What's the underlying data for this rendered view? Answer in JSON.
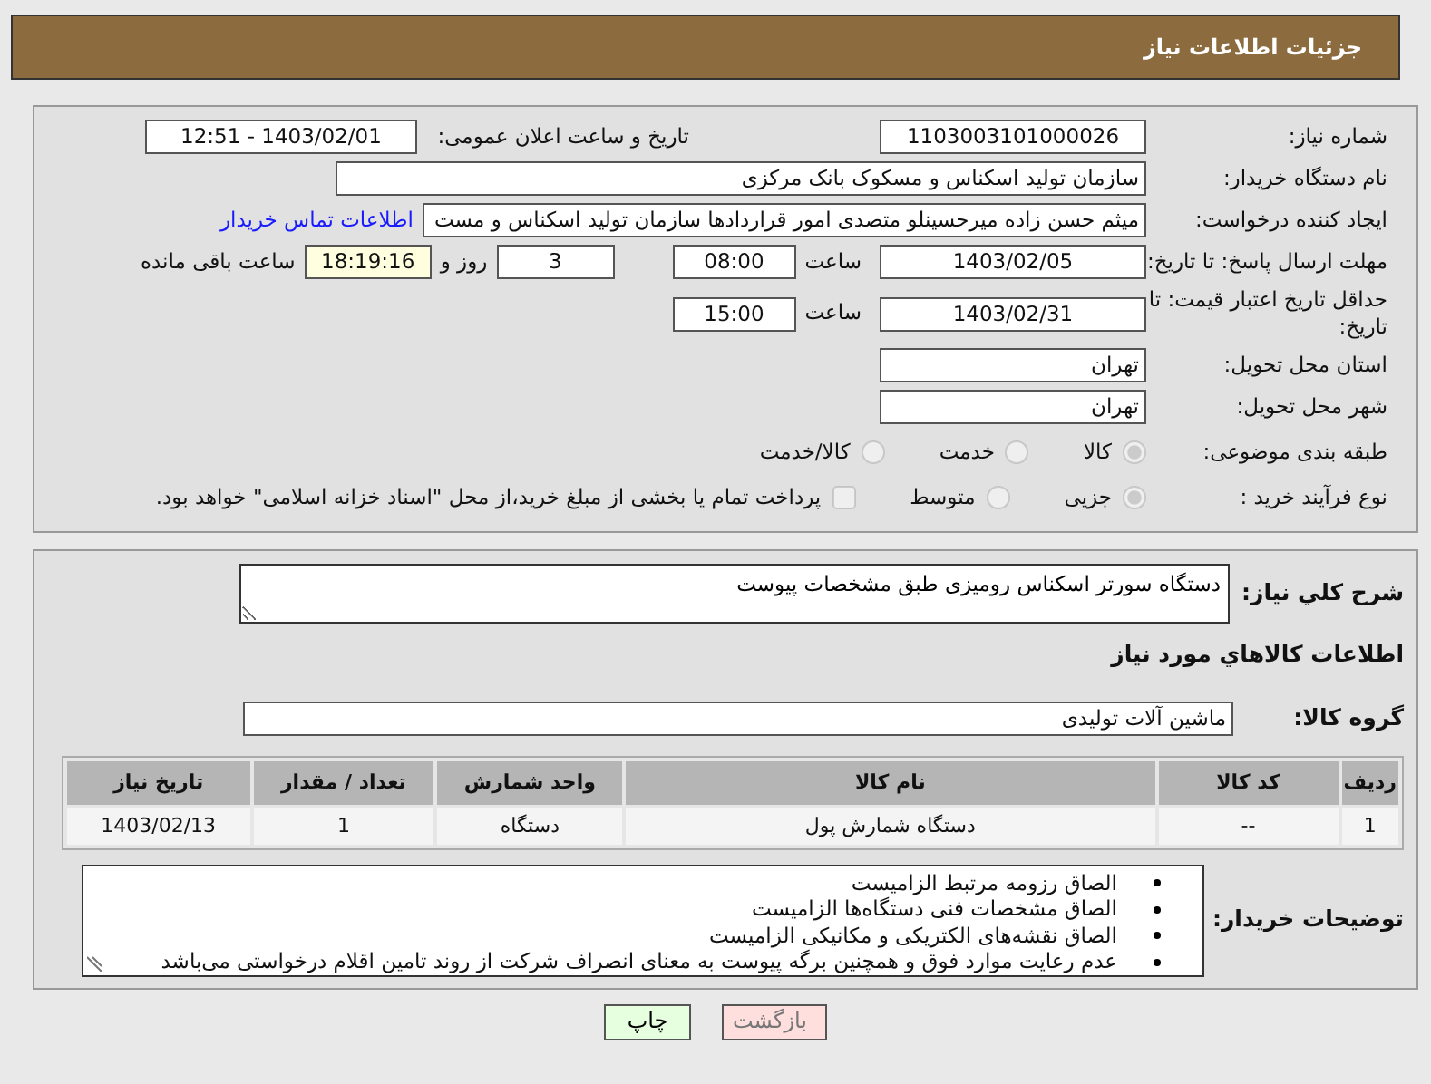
{
  "header": {
    "title": "جزئیات اطلاعات نیاز"
  },
  "need_number": {
    "label": "شماره نیاز:",
    "value": "1103003101000026"
  },
  "announce": {
    "label": "تاریخ و ساعت اعلان عمومی:",
    "value": "1403/02/01 - 12:51"
  },
  "buyer_org": {
    "label": "نام دستگاه خریدار:",
    "value": "سازمان تولید اسکناس و مسکوک بانک مرکزی"
  },
  "requester": {
    "label": "ایجاد کننده درخواست:",
    "value": "میثم حسن زاده میرحسینلو متصدی امور قراردادها سازمان تولید اسکناس و مست",
    "contact_link": "اطلاعات تماس خریدار"
  },
  "response_deadline": {
    "label": "مهلت ارسال پاسخ: تا تاریخ:",
    "date": "1403/02/05",
    "time_label": "ساعت",
    "time": "08:00",
    "days": "3",
    "days_label": "روز و",
    "remaining": "18:19:16",
    "remaining_label": "ساعت باقی مانده"
  },
  "price_validity": {
    "label": "حداقل تاریخ اعتبار قیمت: تا تاریخ:",
    "date": "1403/02/31",
    "time_label": "ساعت",
    "time": "15:00"
  },
  "province": {
    "label": "استان محل تحویل:",
    "value": "تهران"
  },
  "city": {
    "label": "شهر محل تحویل:",
    "value": "تهران"
  },
  "category": {
    "label": "طبقه بندی موضوعی:",
    "options": [
      {
        "label": "کالا",
        "selected": true
      },
      {
        "label": "خدمت",
        "selected": false
      },
      {
        "label": "کالا/خدمت",
        "selected": false
      }
    ]
  },
  "purchase_type": {
    "label": "نوع فرآیند خرید :",
    "options": [
      {
        "label": "جزیی",
        "selected": true
      },
      {
        "label": "متوسط",
        "selected": false
      }
    ],
    "treasury": {
      "label": "پرداخت تمام یا بخشی از مبلغ خرید،از محل \"اسناد خزانه اسلامی\" خواهد بود.",
      "checked": false
    }
  },
  "description": {
    "label": "شرح کلي نیاز:",
    "value": "دستگاه سورتر اسکناس رومیزی طبق مشخصات پیوست"
  },
  "items_heading": "اطلاعات کالاهاي مورد نیاز",
  "goods_group": {
    "label": "گروه کالا:",
    "value": "ماشین آلات تولیدی"
  },
  "table": {
    "columns": [
      "ردیف",
      "کد کالا",
      "نام کالا",
      "واحد شمارش",
      "تعداد / مقدار",
      "تاریخ نیاز"
    ],
    "rows": [
      [
        "1",
        "--",
        "دستگاه شمارش پول",
        "دستگاه",
        "1",
        "1403/02/13"
      ]
    ]
  },
  "buyer_notes": {
    "label": "توضیحات خریدار:",
    "items": [
      "الصاق رزومه مرتبط الزامیست",
      "الصاق مشخصات فنی دستگاه‌ها الزامیست",
      "الصاق نقشه‌های الکتریکی و مکانیکی الزامیست",
      "عدم رعایت موارد فوق و همچنین برگه پیوست به معنای انصراف شرکت از روند تامین اقلام درخواستی می‌باشد"
    ]
  },
  "buttons": [
    {
      "label": "بازگشت",
      "kind": "back"
    },
    {
      "label": "چاپ",
      "kind": "print"
    }
  ]
}
